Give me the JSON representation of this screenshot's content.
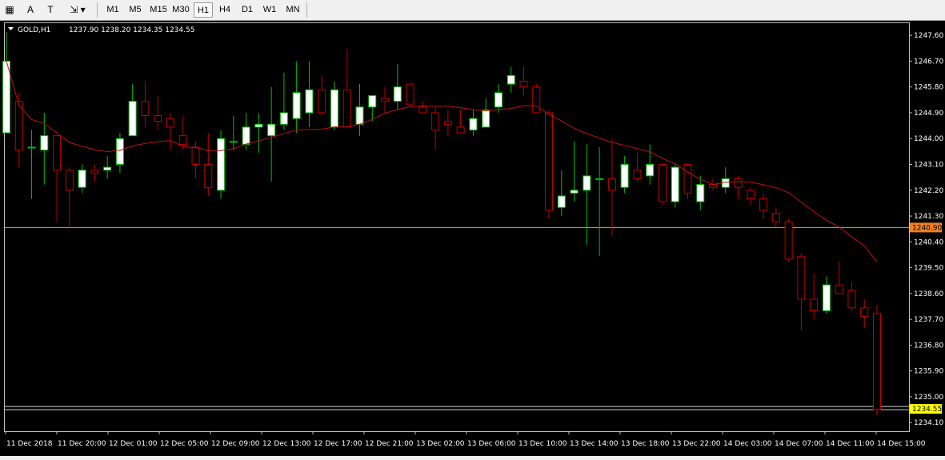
{
  "toolbar": {
    "timeframes": [
      {
        "label": "M1",
        "active": false
      },
      {
        "label": "M5",
        "active": false
      },
      {
        "label": "M15",
        "active": false
      },
      {
        "label": "M30",
        "active": false
      },
      {
        "label": "H1",
        "active": true
      },
      {
        "label": "H4",
        "active": false
      },
      {
        "label": "D1",
        "active": false
      },
      {
        "label": "W1",
        "active": false
      },
      {
        "label": "MN",
        "active": false
      }
    ],
    "tools": [
      {
        "icon": "crosshair-grid-icon",
        "glyph": "▦"
      },
      {
        "icon": "text-tool-icon",
        "glyph": "A"
      },
      {
        "icon": "text-label-icon",
        "glyph": "T"
      },
      {
        "icon": "arrows-shapes-icon",
        "glyph": "⇲"
      }
    ]
  },
  "chart_header": {
    "symbol": "GOLD,H1",
    "ohlc": "1237.90 1238.20 1234.35 1234.55"
  },
  "colors": {
    "background": "#000000",
    "bull_fill": "#ffffff",
    "bull_wick": "#00c000",
    "bear_fill": "#000000",
    "bear_border": "#c00000",
    "ma_line": "#c01010",
    "hline": "#e0a060",
    "current_price_line": "#cfcfcf",
    "axis_text": "#ffffff",
    "label_bg_orange": "#f08020",
    "label_bg_yellow": "#ffff00"
  },
  "chart_data": {
    "type": "candlestick",
    "y_ticks": [
      "1247.60",
      "1246.70",
      "1245.80",
      "1244.90",
      "1244.00",
      "1243.10",
      "1242.20",
      "1241.30",
      "1240.40",
      "1239.50",
      "1238.60",
      "1237.70",
      "1236.80",
      "1235.90",
      "1235.00",
      "1234.10"
    ],
    "ylim": [
      1233.8,
      1248.05
    ],
    "x_ticks": [
      "11 Dec 2018",
      "11 Dec 20:00",
      "12 Dec 01:00",
      "12 Dec 05:00",
      "12 Dec 09:00",
      "12 Dec 13:00",
      "12 Dec 17:00",
      "12 Dec 21:00",
      "13 Dec 02:00",
      "13 Dec 06:00",
      "13 Dec 10:00",
      "13 Dec 14:00",
      "13 Dec 18:00",
      "13 Dec 22:00",
      "14 Dec 03:00",
      "14 Dec 07:00",
      "14 Dec 11:00",
      "14 Dec 15:00"
    ],
    "horizontal_line": {
      "value": 1240.9,
      "label": "1240.90"
    },
    "current_price": {
      "value": 1234.55,
      "label": "1234.55"
    },
    "candles": [
      {
        "o": 1244.2,
        "h": 1247.7,
        "l": 1244.2,
        "c": 1246.7
      },
      {
        "o": 1245.3,
        "h": 1245.6,
        "l": 1243.0,
        "c": 1243.6
      },
      {
        "o": 1243.7,
        "h": 1244.3,
        "l": 1241.9,
        "c": 1243.7
      },
      {
        "o": 1243.6,
        "h": 1244.9,
        "l": 1242.4,
        "c": 1244.1
      },
      {
        "o": 1244.1,
        "h": 1244.1,
        "l": 1241.1,
        "c": 1242.9
      },
      {
        "o": 1242.9,
        "h": 1243.0,
        "l": 1240.9,
        "c": 1242.2
      },
      {
        "o": 1242.3,
        "h": 1243.1,
        "l": 1242.1,
        "c": 1242.9
      },
      {
        "o": 1242.9,
        "h": 1243.1,
        "l": 1242.5,
        "c": 1242.8
      },
      {
        "o": 1242.9,
        "h": 1243.4,
        "l": 1242.6,
        "c": 1243.0
      },
      {
        "o": 1243.1,
        "h": 1244.2,
        "l": 1242.8,
        "c": 1244.0
      },
      {
        "o": 1244.1,
        "h": 1245.9,
        "l": 1244.1,
        "c": 1245.3
      },
      {
        "o": 1245.3,
        "h": 1246.0,
        "l": 1244.4,
        "c": 1244.8
      },
      {
        "o": 1244.8,
        "h": 1245.5,
        "l": 1244.3,
        "c": 1244.6
      },
      {
        "o": 1244.7,
        "h": 1244.9,
        "l": 1243.6,
        "c": 1244.4
      },
      {
        "o": 1244.1,
        "h": 1244.8,
        "l": 1243.6,
        "c": 1243.8
      },
      {
        "o": 1243.7,
        "h": 1243.9,
        "l": 1242.6,
        "c": 1243.1
      },
      {
        "o": 1243.1,
        "h": 1244.2,
        "l": 1242.0,
        "c": 1242.3
      },
      {
        "o": 1242.2,
        "h": 1244.3,
        "l": 1241.9,
        "c": 1244.0
      },
      {
        "o": 1243.9,
        "h": 1244.8,
        "l": 1243.6,
        "c": 1243.9
      },
      {
        "o": 1243.8,
        "h": 1244.9,
        "l": 1243.6,
        "c": 1244.4
      },
      {
        "o": 1244.4,
        "h": 1244.9,
        "l": 1243.5,
        "c": 1244.5
      },
      {
        "o": 1244.1,
        "h": 1245.8,
        "l": 1242.5,
        "c": 1244.5
      },
      {
        "o": 1244.5,
        "h": 1246.3,
        "l": 1244.3,
        "c": 1244.9
      },
      {
        "o": 1244.7,
        "h": 1246.7,
        "l": 1244.2,
        "c": 1245.6
      },
      {
        "o": 1244.9,
        "h": 1246.7,
        "l": 1244.4,
        "c": 1245.7
      },
      {
        "o": 1245.7,
        "h": 1246.2,
        "l": 1244.8,
        "c": 1244.9
      },
      {
        "o": 1244.4,
        "h": 1246.0,
        "l": 1244.3,
        "c": 1245.7
      },
      {
        "o": 1245.7,
        "h": 1247.1,
        "l": 1244.4,
        "c": 1244.4
      },
      {
        "o": 1244.5,
        "h": 1245.9,
        "l": 1244.1,
        "c": 1245.1
      },
      {
        "o": 1245.1,
        "h": 1245.5,
        "l": 1244.6,
        "c": 1245.5
      },
      {
        "o": 1245.4,
        "h": 1245.8,
        "l": 1244.9,
        "c": 1245.3
      },
      {
        "o": 1245.3,
        "h": 1246.6,
        "l": 1245.0,
        "c": 1245.8
      },
      {
        "o": 1245.9,
        "h": 1245.9,
        "l": 1245.2,
        "c": 1245.2
      },
      {
        "o": 1245.1,
        "h": 1245.3,
        "l": 1244.9,
        "c": 1244.9
      },
      {
        "o": 1244.9,
        "h": 1245.1,
        "l": 1243.6,
        "c": 1244.3
      },
      {
        "o": 1244.6,
        "h": 1245.0,
        "l": 1244.1,
        "c": 1244.5
      },
      {
        "o": 1244.4,
        "h": 1245.0,
        "l": 1244.2,
        "c": 1244.2
      },
      {
        "o": 1244.3,
        "h": 1245.0,
        "l": 1244.1,
        "c": 1244.7
      },
      {
        "o": 1244.4,
        "h": 1245.4,
        "l": 1244.4,
        "c": 1245.0
      },
      {
        "o": 1245.1,
        "h": 1245.9,
        "l": 1244.9,
        "c": 1245.6
      },
      {
        "o": 1245.9,
        "h": 1246.5,
        "l": 1245.6,
        "c": 1246.2
      },
      {
        "o": 1246.0,
        "h": 1246.5,
        "l": 1245.5,
        "c": 1245.8
      },
      {
        "o": 1245.8,
        "h": 1245.9,
        "l": 1244.9,
        "c": 1244.9
      },
      {
        "o": 1244.9,
        "h": 1245.0,
        "l": 1241.2,
        "c": 1241.5
      },
      {
        "o": 1241.6,
        "h": 1242.9,
        "l": 1241.3,
        "c": 1242.0
      },
      {
        "o": 1242.1,
        "h": 1243.9,
        "l": 1241.8,
        "c": 1242.2
      },
      {
        "o": 1242.2,
        "h": 1243.8,
        "l": 1240.3,
        "c": 1242.7
      },
      {
        "o": 1242.6,
        "h": 1243.7,
        "l": 1239.9,
        "c": 1242.6
      },
      {
        "o": 1242.6,
        "h": 1244.0,
        "l": 1240.6,
        "c": 1242.2
      },
      {
        "o": 1242.3,
        "h": 1243.4,
        "l": 1242.1,
        "c": 1243.1
      },
      {
        "o": 1242.9,
        "h": 1243.5,
        "l": 1242.5,
        "c": 1242.6
      },
      {
        "o": 1242.7,
        "h": 1243.8,
        "l": 1242.4,
        "c": 1243.1
      },
      {
        "o": 1243.1,
        "h": 1243.1,
        "l": 1241.7,
        "c": 1241.8
      },
      {
        "o": 1241.8,
        "h": 1243.1,
        "l": 1241.6,
        "c": 1243.0
      },
      {
        "o": 1243.1,
        "h": 1243.1,
        "l": 1241.9,
        "c": 1242.1
      },
      {
        "o": 1241.8,
        "h": 1242.7,
        "l": 1241.5,
        "c": 1242.4
      },
      {
        "o": 1242.4,
        "h": 1242.6,
        "l": 1242.2,
        "c": 1242.3
      },
      {
        "o": 1242.3,
        "h": 1243.0,
        "l": 1242.1,
        "c": 1242.6
      },
      {
        "o": 1242.6,
        "h": 1242.7,
        "l": 1241.9,
        "c": 1242.3
      },
      {
        "o": 1242.2,
        "h": 1242.3,
        "l": 1241.7,
        "c": 1241.9
      },
      {
        "o": 1241.9,
        "h": 1242.1,
        "l": 1241.2,
        "c": 1241.5
      },
      {
        "o": 1241.4,
        "h": 1241.6,
        "l": 1240.9,
        "c": 1241.1
      },
      {
        "o": 1241.1,
        "h": 1241.2,
        "l": 1239.7,
        "c": 1239.8
      },
      {
        "o": 1239.9,
        "h": 1240.0,
        "l": 1237.3,
        "c": 1238.4
      },
      {
        "o": 1238.4,
        "h": 1239.3,
        "l": 1237.7,
        "c": 1238.0
      },
      {
        "o": 1238.0,
        "h": 1239.2,
        "l": 1237.9,
        "c": 1238.9
      },
      {
        "o": 1238.9,
        "h": 1239.7,
        "l": 1238.6,
        "c": 1238.6
      },
      {
        "o": 1238.7,
        "h": 1239.0,
        "l": 1238.0,
        "c": 1238.1
      },
      {
        "o": 1238.1,
        "h": 1238.4,
        "l": 1237.4,
        "c": 1237.8
      },
      {
        "o": 1237.9,
        "h": 1238.2,
        "l": 1234.35,
        "c": 1234.55
      }
    ]
  }
}
